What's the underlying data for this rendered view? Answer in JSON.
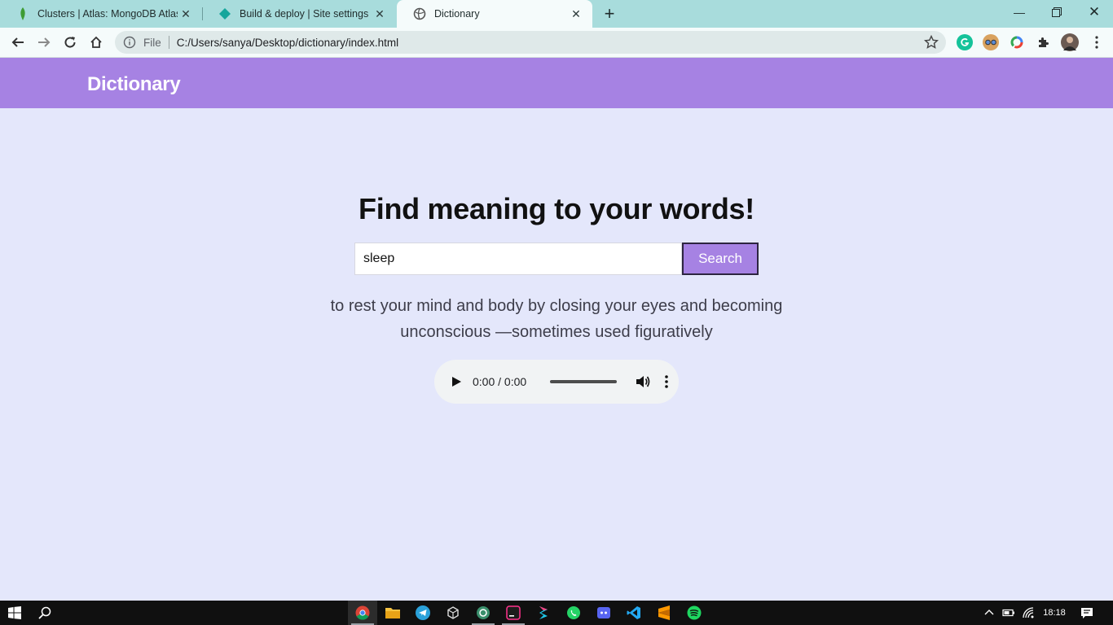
{
  "browser": {
    "tabs": [
      {
        "title": "Clusters | Atlas: MongoDB Atlas",
        "icon": "mongodb-leaf-icon"
      },
      {
        "title": "Build & deploy | Site settings",
        "icon": "netlify-diamond-icon"
      },
      {
        "title": "Dictionary",
        "icon": "globe-icon"
      }
    ],
    "active_tab": 2,
    "url_scheme": "File",
    "url": "C:/Users/sanya/Desktop/dictionary/index.html"
  },
  "app": {
    "title": "Dictionary"
  },
  "main": {
    "headline": "Find meaning to your words!",
    "search": {
      "value": "sleep",
      "button_label": "Search"
    },
    "definition": "to rest your mind and body by closing your eyes and becoming unconscious —sometimes used figuratively",
    "audio": {
      "time": "0:00 / 0:00"
    }
  },
  "taskbar": {
    "clock": "18:18",
    "apps": [
      "chrome-icon",
      "file-explorer-icon",
      "telegram-icon",
      "unity-icon",
      "postman-icon",
      "jetbrains-icon",
      "sketch-icon",
      "whatsapp-icon",
      "discord-icon",
      "vscode-icon",
      "sublime-icon",
      "spotify-icon"
    ]
  },
  "colors": {
    "header": "#a682e3",
    "page_background": "#e4e7fb",
    "tabstrip": "#a8dcdc"
  }
}
